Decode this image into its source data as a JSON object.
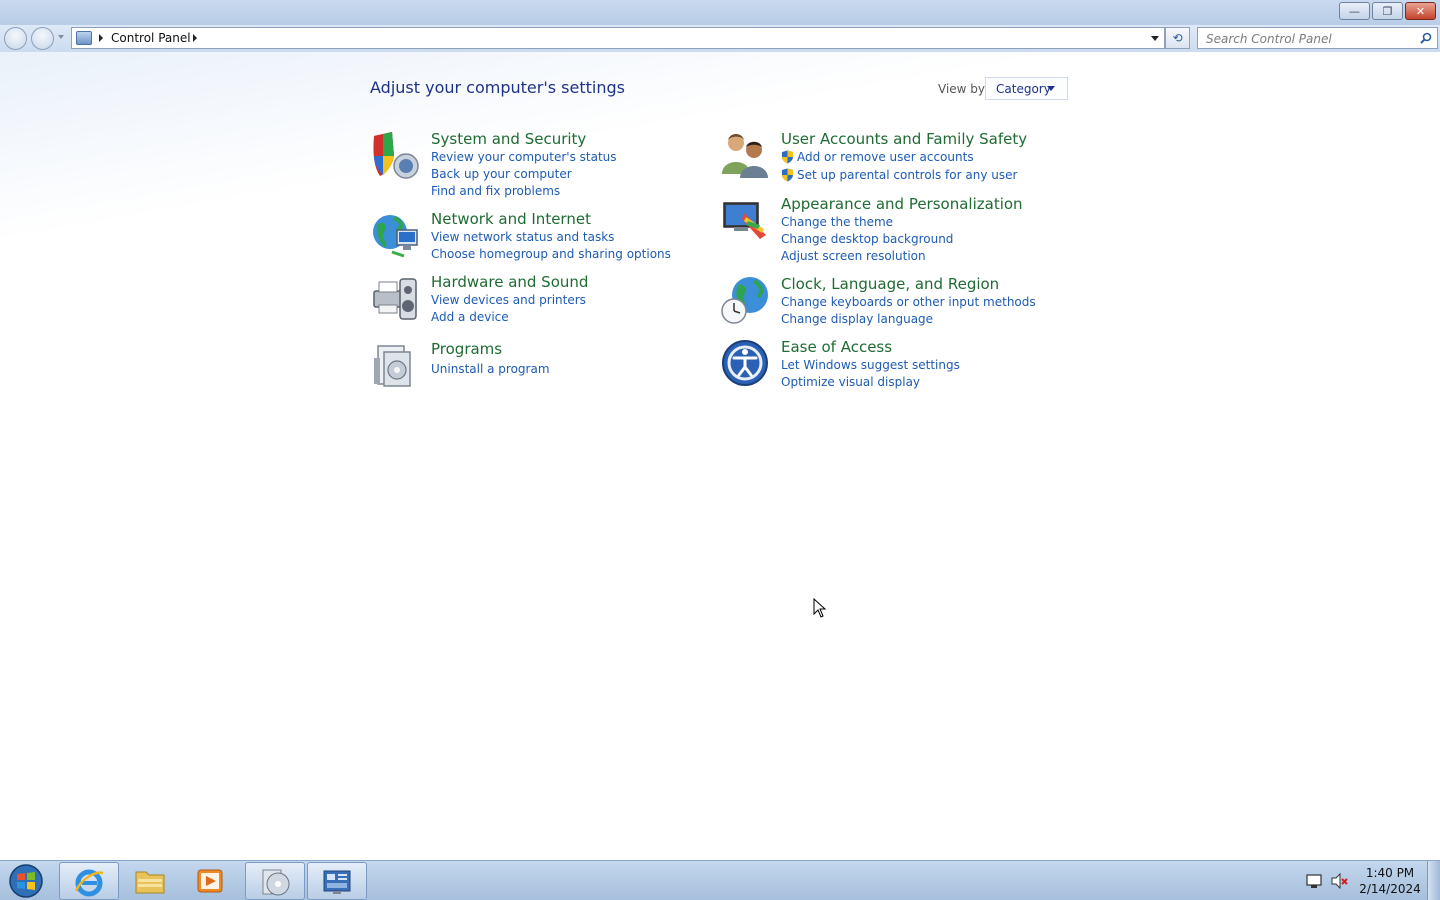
{
  "window": {
    "caption": {
      "minimize": "—",
      "restore": "❐",
      "close": "✕"
    }
  },
  "navigation": {
    "breadcrumb": [
      "Control Panel"
    ],
    "refresh_glyph": "⟲",
    "search_placeholder": "Search Control Panel"
  },
  "main": {
    "title": "Adjust your computer's settings",
    "view_by_label": "View by:",
    "view_by_value": "Category",
    "categories": [
      {
        "icon": "system-security-shield-icon",
        "title": "System and Security",
        "links": [
          "Review your computer's status",
          "Back up your computer",
          "Find and fix problems"
        ]
      },
      {
        "icon": "network-globe-icon",
        "title": "Network and Internet",
        "links": [
          "View network status and tasks",
          "Choose homegroup and sharing options"
        ]
      },
      {
        "icon": "printer-speaker-icon",
        "title": "Hardware and Sound",
        "links": [
          "View devices and printers",
          "Add a device"
        ]
      },
      {
        "icon": "programs-box-icon",
        "title": "Programs",
        "links": [
          "Uninstall a program"
        ]
      },
      {
        "icon": "users-icon",
        "title": "User Accounts and Family Safety",
        "links": [
          "Add or remove user accounts",
          "Set up parental controls for any user"
        ]
      },
      {
        "icon": "monitor-palette-icon",
        "title": "Appearance and Personalization",
        "links": [
          "Change the theme",
          "Change desktop background",
          "Adjust screen resolution"
        ]
      },
      {
        "icon": "clock-globe-icon",
        "title": "Clock, Language, and Region",
        "links": [
          "Change keyboards or other input methods",
          "Change display language"
        ]
      },
      {
        "icon": "ease-of-access-icon",
        "title": "Ease of Access",
        "links": [
          "Let Windows suggest settings",
          "Optimize visual display"
        ]
      }
    ]
  },
  "taskbar": {
    "pinned": [
      "internet-explorer-icon",
      "file-explorer-icon",
      "media-player-icon",
      "disc-burner-icon",
      "control-panel-icon"
    ],
    "active": "control-panel-icon",
    "clock_time": "1:40 PM",
    "clock_date": "2/14/2024"
  },
  "colors": {
    "category_title": "#1f6b33",
    "link": "#1e5bb4",
    "page_title": "#1e3287"
  }
}
